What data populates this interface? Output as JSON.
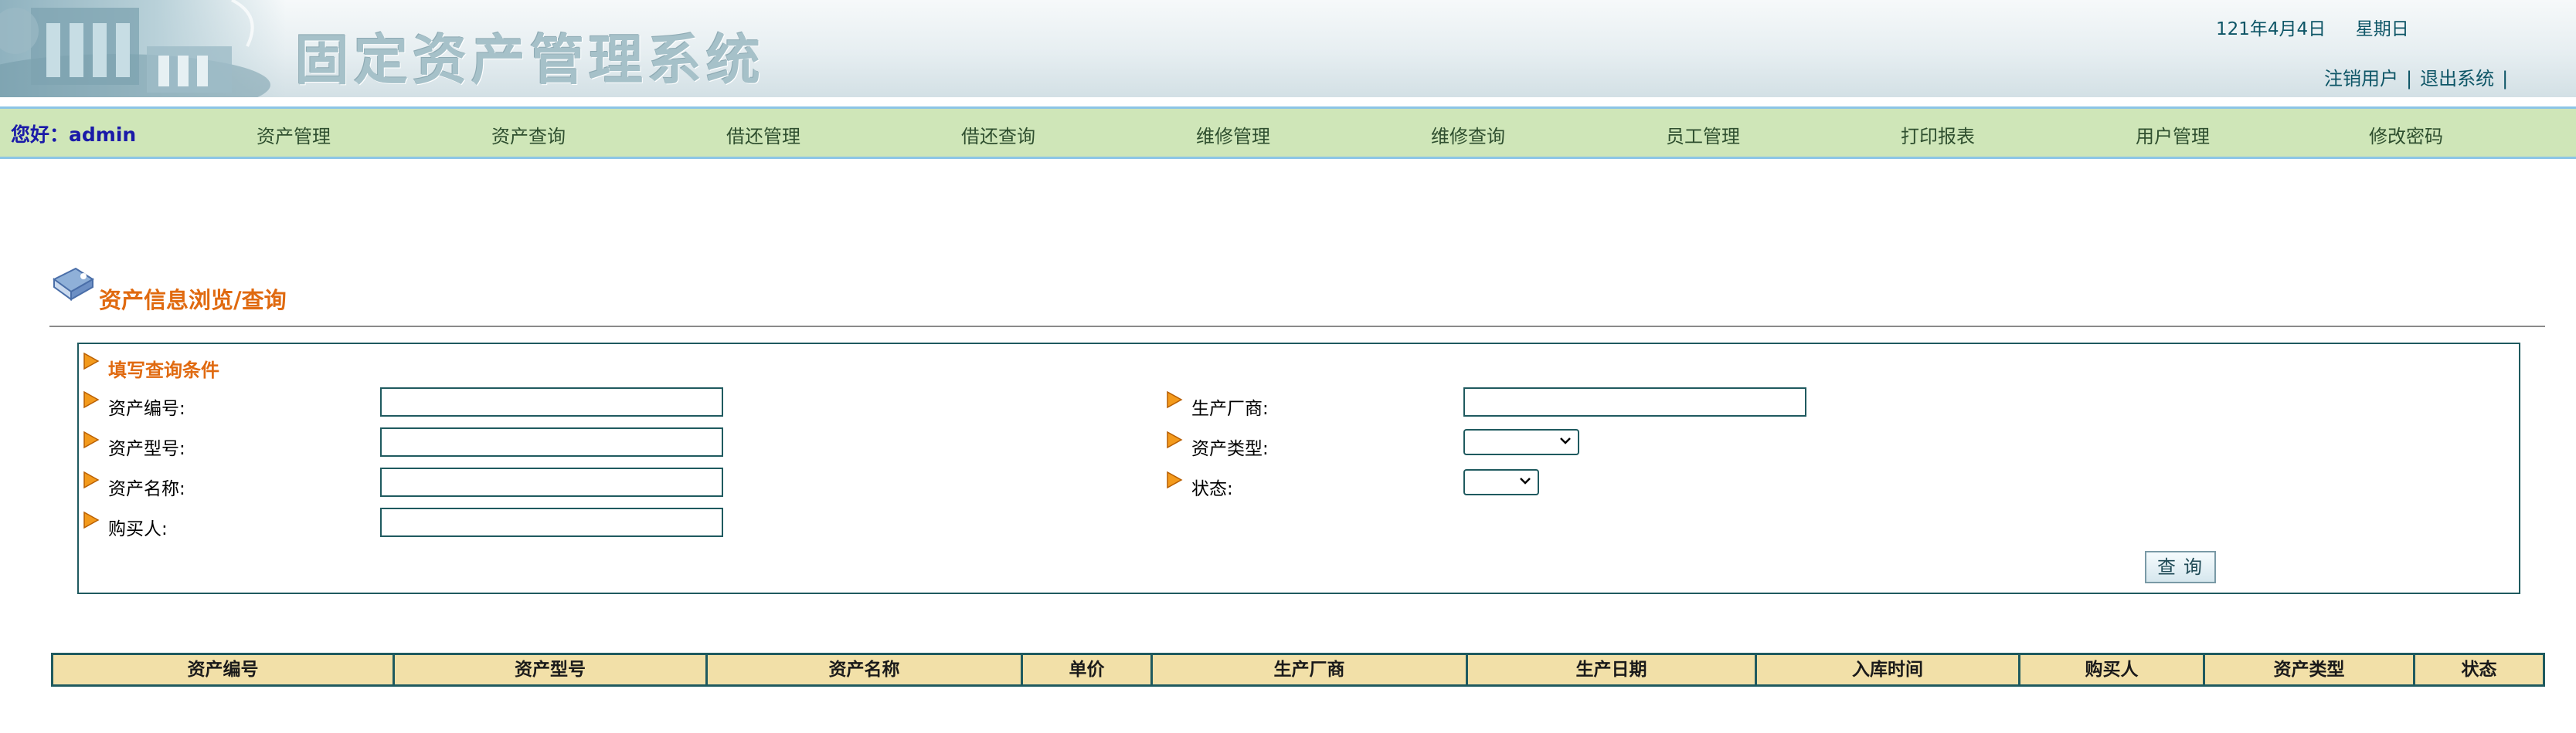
{
  "header": {
    "title": "固定资产管理系统",
    "date": "121年4月4日",
    "weekday": "星期日",
    "logout_user": "注销用户",
    "exit_system": "退出系统",
    "separator": "|"
  },
  "nav": {
    "greeting": "您好：admin",
    "items": [
      "资产管理",
      "资产查询",
      "借还管理",
      "借还查询",
      "维修管理",
      "维修查询",
      "员工管理",
      "打印报表",
      "用户管理",
      "修改密码"
    ]
  },
  "page": {
    "title": "资产信息浏览/查询"
  },
  "query": {
    "section_title": "填写查询条件",
    "asset_no_label": "资产编号:",
    "asset_model_label": "资产型号:",
    "asset_name_label": "资产名称:",
    "buyer_label": "购买人:",
    "manufacturer_label": "生产厂商:",
    "asset_type_label": "资产类型:",
    "status_label": "状态:",
    "asset_no_value": "",
    "asset_model_value": "",
    "asset_name_value": "",
    "buyer_value": "",
    "manufacturer_value": "",
    "asset_type_selected": "",
    "status_selected": "",
    "search_button": "查询"
  },
  "table": {
    "headers": [
      "资产编号",
      "资产型号",
      "资产名称",
      "单价",
      "生产厂商",
      "生产日期",
      "入库时间",
      "购买人",
      "资产类型",
      "状态"
    ]
  },
  "colors": {
    "accent_orange": "#e06a10",
    "nav_green": "#cfe6b8",
    "header_yellow": "#f2e0a8",
    "border_teal": "#1f5a5f"
  }
}
